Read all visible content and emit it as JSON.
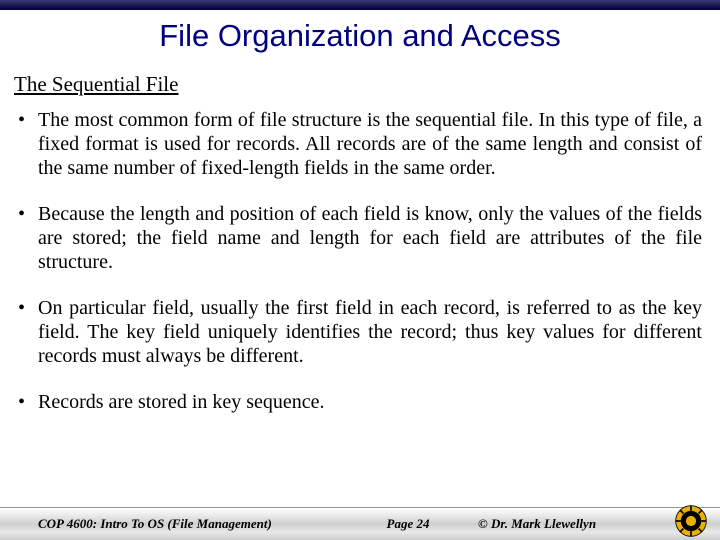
{
  "title": "File Organization and Access",
  "subtitle": "The Sequential File",
  "bullets": [
    "The most common form of file structure is the sequential file.  In this type of file, a fixed format is used for records.  All records are of the same length and consist of the same number of fixed-length fields in the same order.",
    "Because the length and position of each field is know, only the values of the fields are stored; the field name and length for each field are attributes of the file structure.",
    "On particular field, usually the first field in each record, is referred to as the key field.  The key field uniquely identifies the record; thus key values for different records must always be different.",
    "Records are stored in key sequence."
  ],
  "footer": {
    "course": "COP 4600: Intro To OS  (File Management)",
    "page": "Page 24",
    "author": "© Dr. Mark Llewellyn"
  }
}
